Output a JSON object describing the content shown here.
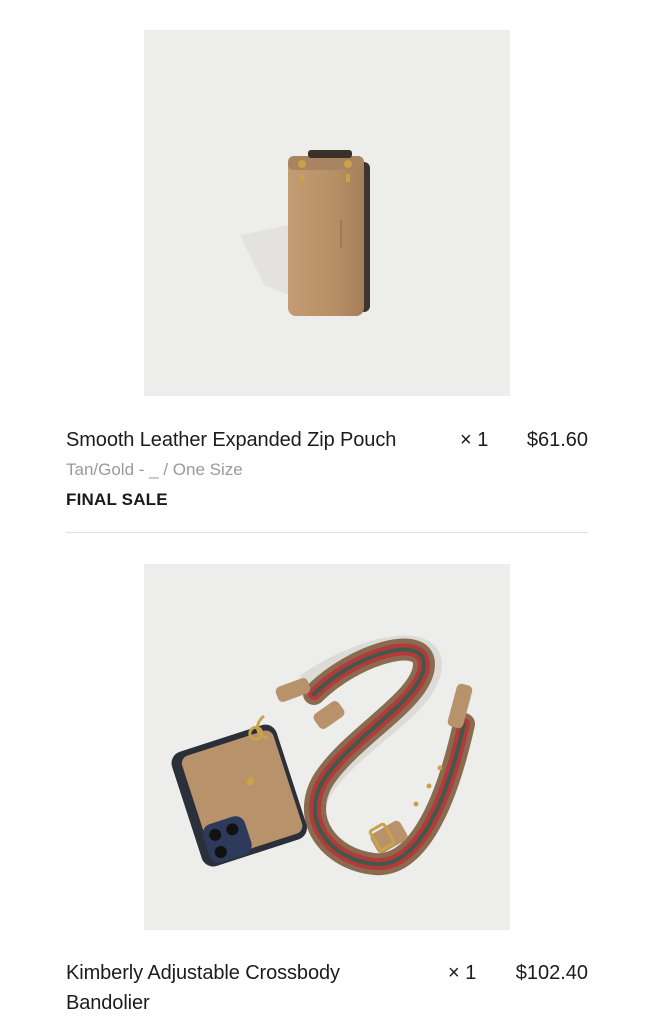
{
  "items": [
    {
      "title": "Smooth Leather Expanded Zip Pouch",
      "quantity": "× 1",
      "price": "$61.60",
      "variant": "Tan/Gold - _ / One Size",
      "badge": "FINAL SALE",
      "image_icon": "zip-pouch-product-image"
    },
    {
      "title": "Kimberly Adjustable Crossbody Bandolier",
      "quantity": "× 1",
      "price": "$102.40",
      "image_icon": "crossbody-bandolier-product-image"
    }
  ],
  "colors": {
    "image_background": "#ededeb",
    "text_primary": "#1c1c1c",
    "text_secondary": "#9a9a9a",
    "divider": "#e0e0e0",
    "tan_leather": "#b8926a",
    "strap_red": "#b23a3a",
    "strap_green": "#3f5a4a"
  }
}
